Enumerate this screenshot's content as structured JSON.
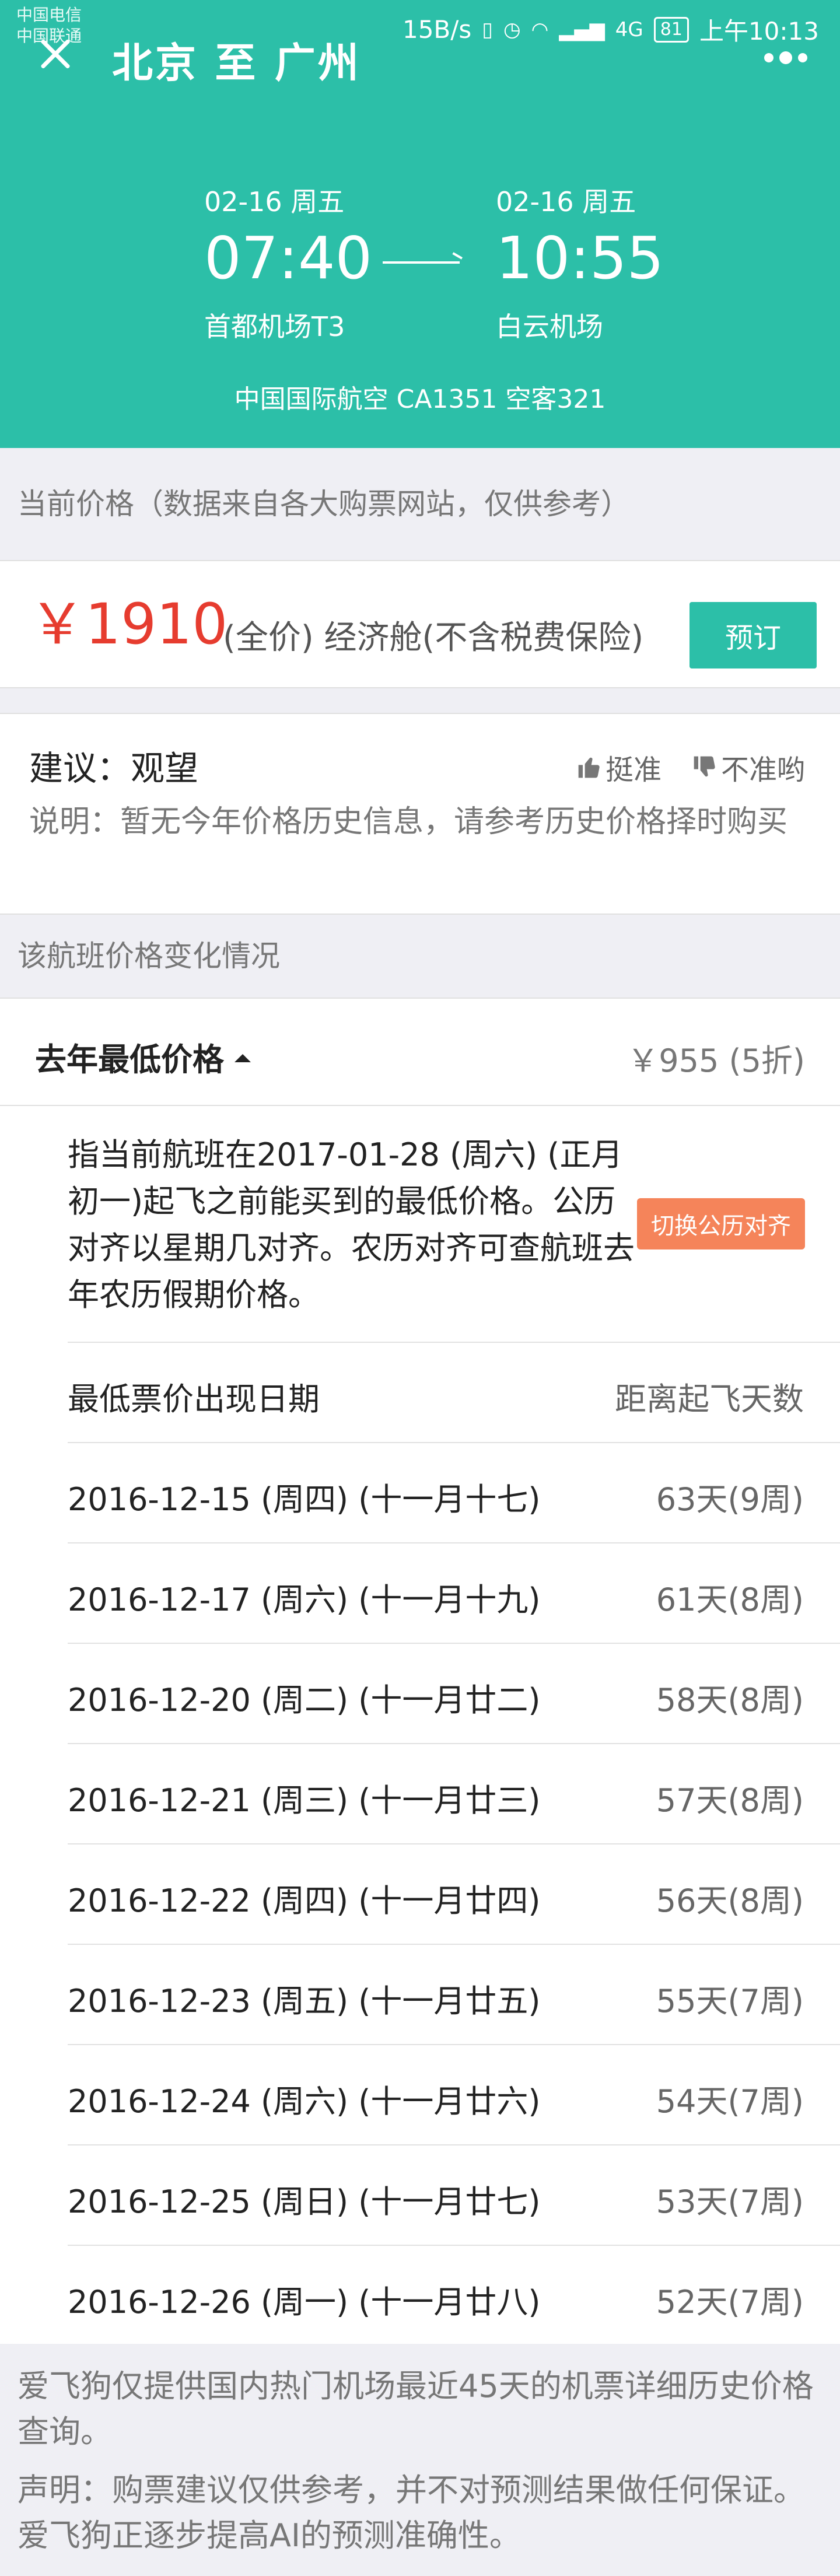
{
  "status_bar": {
    "carrier1": "中国电信",
    "carrier2": "中国联通",
    "speed": "15B/s",
    "network": "4G",
    "battery": "81",
    "time": "上午10:13"
  },
  "header": {
    "title": "北京 至 广州",
    "departure": {
      "date": "02-16 周五",
      "time": "07:40",
      "airport": "首都机场T3"
    },
    "arrival": {
      "date": "02-16 周五",
      "time": "10:55",
      "airport": "白云机场"
    },
    "flight_info": "中国国际航空 CA1351   空客321"
  },
  "price_note": "当前价格（数据来自各大购票网站，仅供参考）",
  "price": {
    "amount": "￥1910",
    "description": "(全价) 经济舱(不含税费保险)",
    "book_label": "预订"
  },
  "advice": {
    "title": "建议：观望",
    "vote_up": "挺准",
    "vote_down": "不准哟",
    "text": "说明：暂无今年价格历史信息，请参考历史价格择时购买"
  },
  "change_head": "该航班价格变化情况",
  "last_year": {
    "label": "去年最低价格",
    "price": "￥955 (5折)",
    "explain": "指当前航班在2017-01-28 (周六) (正月初一)起飞之前能买到的最低价格。公历对齐以星期几对齐。农历对齐可查航班去年农历假期价格。",
    "switch_label": "切换公历对齐",
    "table_header": {
      "date": "最低票价出现日期",
      "days": "距离起飞天数"
    },
    "rows": [
      {
        "date": "2016-12-15 (周四) (十一月十七)",
        "days": "63天(9周)"
      },
      {
        "date": "2016-12-17 (周六) (十一月十九)",
        "days": "61天(8周)"
      },
      {
        "date": "2016-12-20 (周二) (十一月廿二)",
        "days": "58天(8周)"
      },
      {
        "date": "2016-12-21 (周三) (十一月廿三)",
        "days": "57天(8周)"
      },
      {
        "date": "2016-12-22 (周四) (十一月廿四)",
        "days": "56天(8周)"
      },
      {
        "date": "2016-12-23 (周五) (十一月廿五)",
        "days": "55天(7周)"
      },
      {
        "date": "2016-12-24 (周六) (十一月廿六)",
        "days": "54天(7周)"
      },
      {
        "date": "2016-12-25 (周日) (十一月廿七)",
        "days": "53天(7周)"
      },
      {
        "date": "2016-12-26 (周一) (十一月廿八)",
        "days": "52天(7周)"
      }
    ]
  },
  "footer": {
    "line1": "爱飞狗仅提供国内热门机场最近45天的机票详细历史价格查询。",
    "line2": "声明：购票建议仅供参考，并不对预测结果做任何保证。爱飞狗正逐步提高AI的预测准确性。"
  },
  "colors": {
    "accent": "#2cbfa8",
    "price": "#e63c2f",
    "switch": "#f5845a"
  }
}
